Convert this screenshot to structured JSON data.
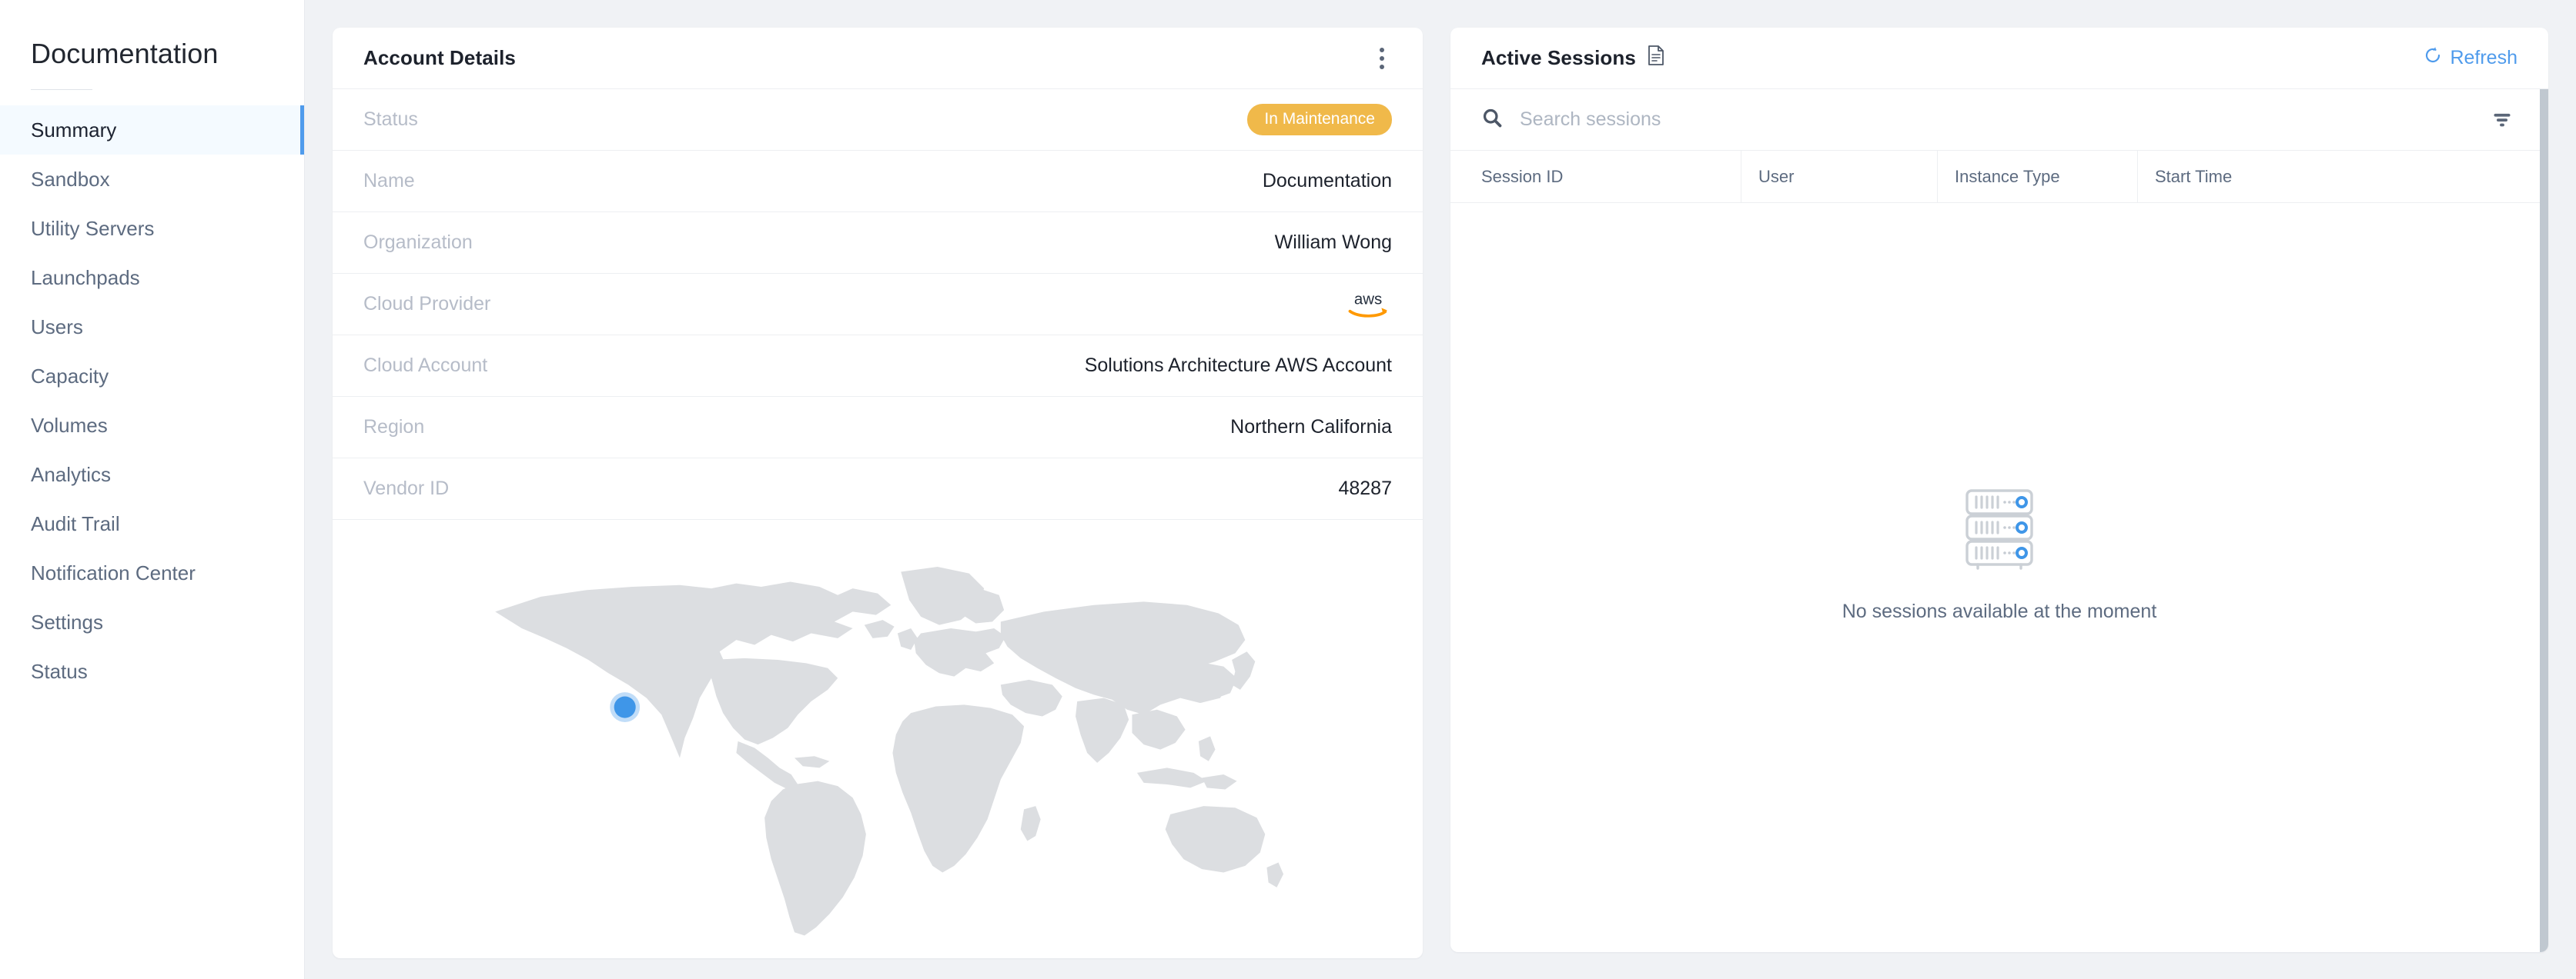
{
  "sidebar": {
    "title": "Documentation",
    "items": [
      {
        "label": "Summary",
        "active": true
      },
      {
        "label": "Sandbox",
        "active": false
      },
      {
        "label": "Utility Servers",
        "active": false
      },
      {
        "label": "Launchpads",
        "active": false
      },
      {
        "label": "Users",
        "active": false
      },
      {
        "label": "Capacity",
        "active": false
      },
      {
        "label": "Volumes",
        "active": false
      },
      {
        "label": "Analytics",
        "active": false
      },
      {
        "label": "Audit Trail",
        "active": false
      },
      {
        "label": "Notification Center",
        "active": false
      },
      {
        "label": "Settings",
        "active": false
      },
      {
        "label": "Status",
        "active": false
      }
    ]
  },
  "account_details": {
    "title": "Account Details",
    "menu_icon": "kebab-menu-icon",
    "rows": [
      {
        "label": "Status",
        "value": "In Maintenance",
        "type": "badge"
      },
      {
        "label": "Name",
        "value": "Documentation",
        "type": "text"
      },
      {
        "label": "Organization",
        "value": "William Wong",
        "type": "text"
      },
      {
        "label": "Cloud Provider",
        "value": "aws",
        "type": "logo"
      },
      {
        "label": "Cloud Account",
        "value": "Solutions Architecture AWS Account",
        "type": "text"
      },
      {
        "label": "Region",
        "value": "Northern California",
        "type": "text"
      },
      {
        "label": "Vendor ID",
        "value": "48287",
        "type": "text"
      }
    ],
    "map": {
      "marker_label": "Northern California",
      "marker_color": "#3f96e8",
      "land_color": "#dcdee1"
    }
  },
  "active_sessions": {
    "title": "Active Sessions",
    "title_icon": "document-icon",
    "refresh_label": "Refresh",
    "refresh_icon": "refresh-icon",
    "search": {
      "placeholder": "Search sessions",
      "value": "",
      "icon": "search-icon"
    },
    "filter_icon": "filter-icon",
    "columns": [
      "Session ID",
      "User",
      "Instance Type",
      "Start Time"
    ],
    "rows": [],
    "empty": {
      "icon": "server-rack-icon",
      "message": "No sessions available at the moment"
    }
  },
  "colors": {
    "accent_blue": "#4f9bec",
    "badge_amber": "#f0b94a",
    "page_background": "#f0f2f5",
    "card_background": "#ffffff",
    "label_gray": "#b6bcc8",
    "text_dark": "#1d222c",
    "muted_text": "#5d6b80"
  }
}
